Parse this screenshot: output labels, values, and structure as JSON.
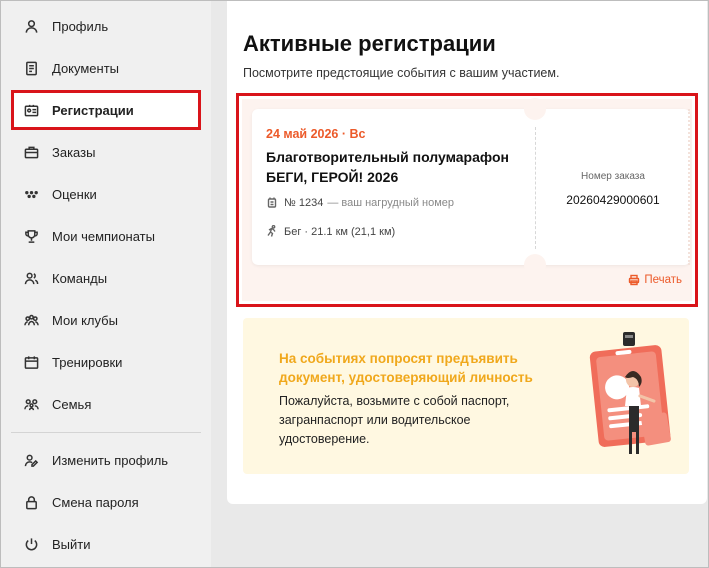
{
  "sidebar": {
    "items": [
      {
        "label": "Профиль",
        "icon": "user-icon"
      },
      {
        "label": "Документы",
        "icon": "document-icon"
      },
      {
        "label": "Регистрации",
        "icon": "id-card-icon",
        "active": true
      },
      {
        "label": "Заказы",
        "icon": "briefcase-icon"
      },
      {
        "label": "Оценки",
        "icon": "dots-icon"
      },
      {
        "label": "Мои чемпионаты",
        "icon": "trophy-icon"
      },
      {
        "label": "Команды",
        "icon": "team-icon"
      },
      {
        "label": "Мои клубы",
        "icon": "clubs-icon"
      },
      {
        "label": "Тренировки",
        "icon": "calendar-icon"
      },
      {
        "label": "Семья",
        "icon": "family-icon"
      }
    ],
    "bottom_items": [
      {
        "label": "Изменить профиль",
        "icon": "edit-profile-icon"
      },
      {
        "label": "Смена пароля",
        "icon": "lock-icon"
      },
      {
        "label": "Выйти",
        "icon": "power-icon"
      }
    ]
  },
  "main": {
    "title": "Активные регистрации",
    "subtitle": "Посмотрите предстоящие события с вашим участием."
  },
  "registration": {
    "date": "24 май 2026 · Вс",
    "event_name": "Благотворительный полумарафон БЕГИ, ГЕРОЙ! 2026",
    "bib": "№ 1234",
    "bib_note": "— ваш нагрудный номер",
    "distance": "Бег · 21.1 км (21,1 км)",
    "order_label": "Номер заказа",
    "order_number": "20260429000601",
    "print_label": "Печать"
  },
  "banner": {
    "title": "На событиях попросят предъявить документ, удостоверяющий личность",
    "text": "Пожалуйста, возьмите с собой паспорт, загранпаспорт или водительское удостоверение."
  },
  "colors": {
    "accent": "#ec5a2a",
    "highlight": "#d9141a",
    "banner_bg": "#fff8e1",
    "banner_title": "#f0a81c"
  }
}
